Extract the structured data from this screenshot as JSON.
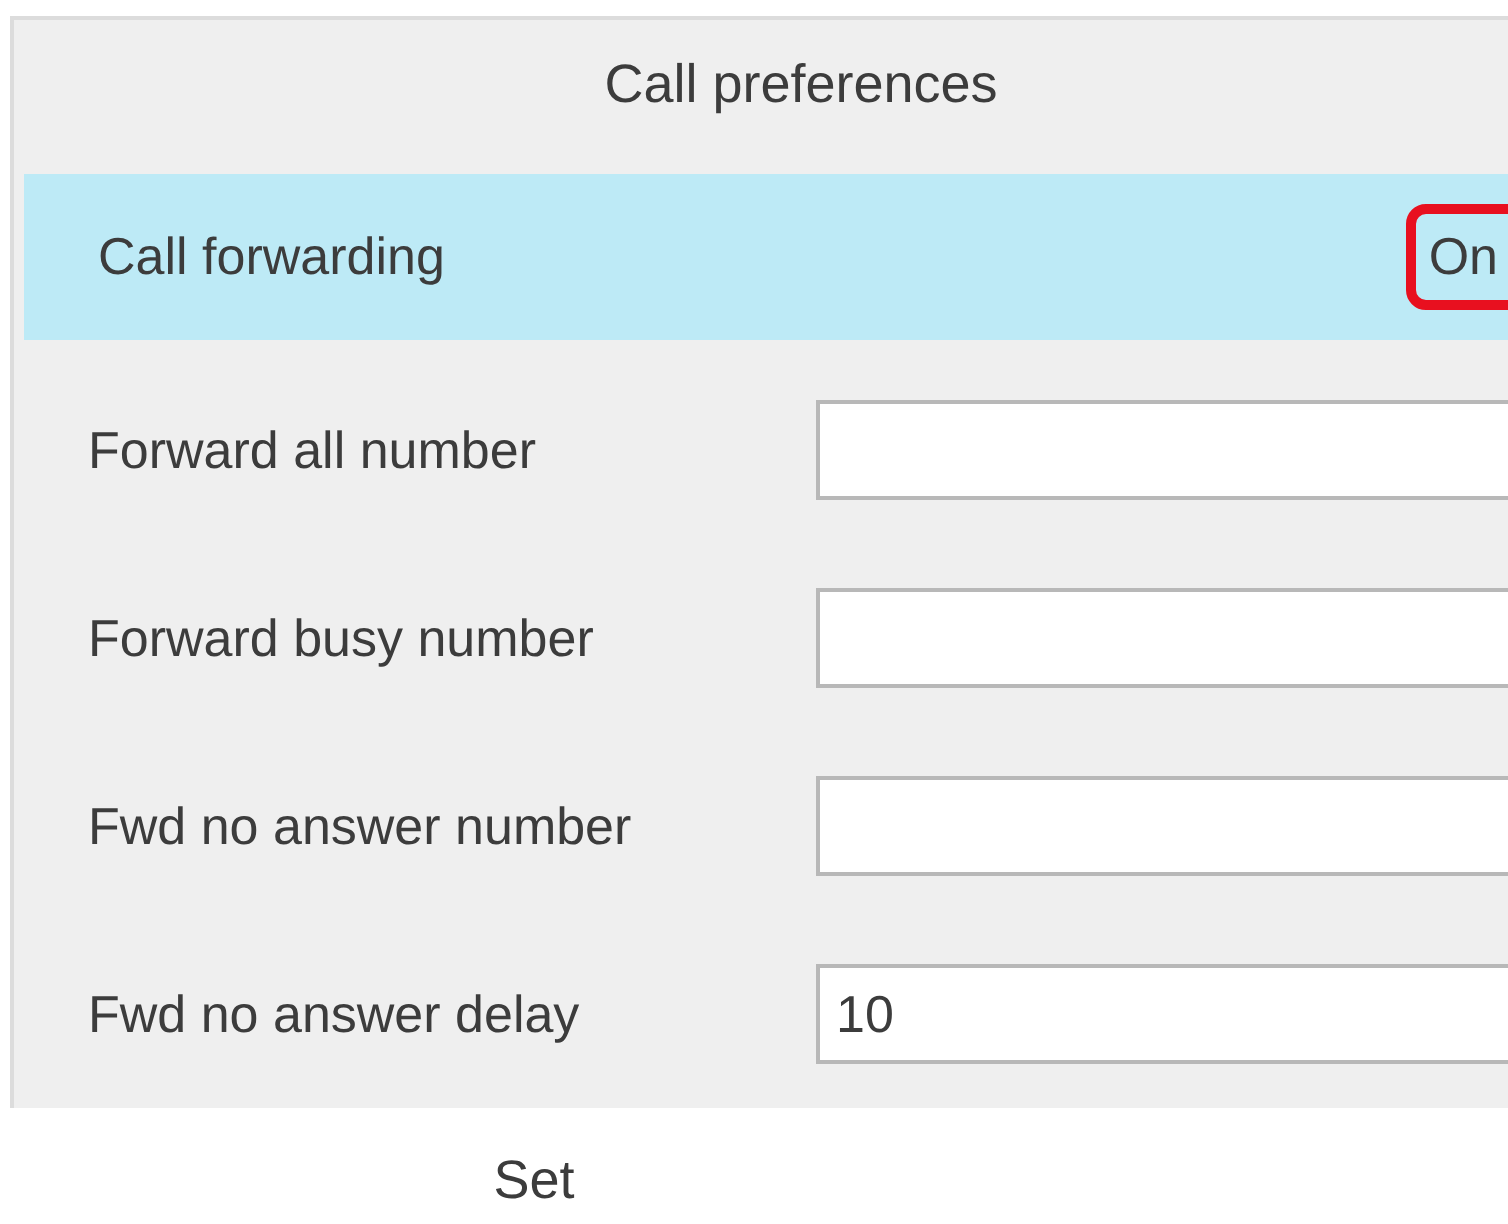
{
  "header": {
    "title": "Call preferences"
  },
  "rows": [
    {
      "kind": "toggle",
      "label": "Call forwarding",
      "value": "On",
      "selected": true,
      "annotated": true
    },
    {
      "kind": "field",
      "label": "Forward all number",
      "selected": false
    },
    {
      "kind": "field",
      "label": "Forward busy number",
      "selected": false
    },
    {
      "kind": "field",
      "label": "Fwd no answer number",
      "selected": false
    },
    {
      "kind": "field",
      "label": "Fwd no answer delay",
      "value": "10",
      "selected": false
    }
  ],
  "softkeys": [
    "Set"
  ]
}
